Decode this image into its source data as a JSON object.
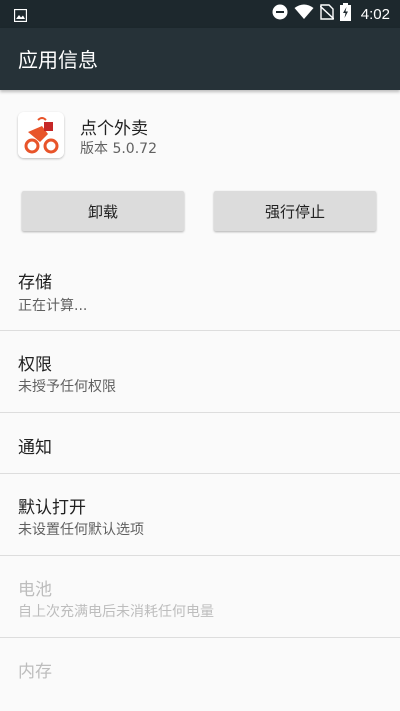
{
  "status_bar": {
    "time": "4:02",
    "icons": [
      "image-icon",
      "do-not-disturb-icon",
      "wifi-icon",
      "no-sim-icon",
      "battery-charging-icon"
    ]
  },
  "app_bar": {
    "title": "应用信息"
  },
  "app": {
    "name": "点个外卖",
    "version": "版本 5.0.72",
    "icon": "app-icon"
  },
  "buttons": {
    "uninstall": "卸载",
    "force_stop": "强行停止"
  },
  "settings": [
    {
      "title": "存储",
      "subtitle": "正在计算..."
    },
    {
      "title": "权限",
      "subtitle": "未授予任何权限"
    },
    {
      "title": "通知"
    },
    {
      "title": "默认打开",
      "subtitle": "未设置任何默认选项"
    },
    {
      "title": "电池",
      "subtitle": "自上次充满电后未消耗任何电量",
      "disabled": true
    },
    {
      "title": "内存",
      "disabled": true
    }
  ],
  "colors": {
    "status_bar": "#1d282d",
    "app_bar": "#263238",
    "background": "#fafafa",
    "button": "#dcdcdc",
    "app_icon_accent": "#e8542a"
  }
}
